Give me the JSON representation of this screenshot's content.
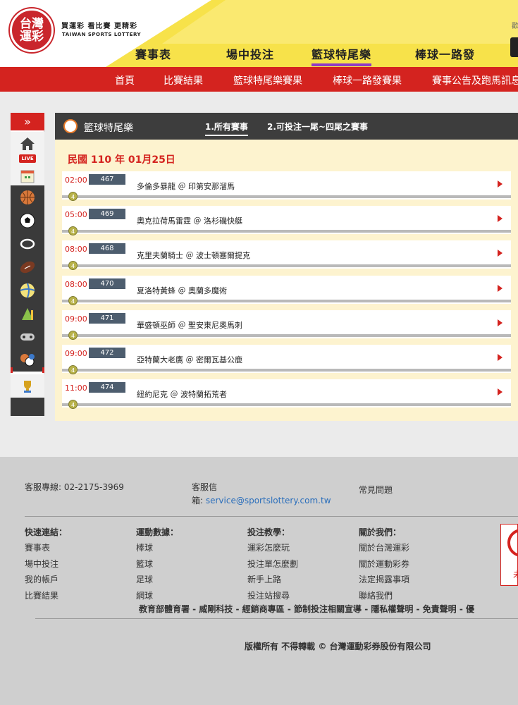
{
  "header": {
    "logo_line1": "台灣",
    "logo_line2": "運彩",
    "slogan": "買運彩  看比賽  更精彩",
    "brand_en": "TAIWAN SPORTS LOTTERY",
    "top_right": "歡",
    "nav": [
      {
        "label": "賽事表"
      },
      {
        "label": "場中投注"
      },
      {
        "label": "籃球特尾樂",
        "active": true
      },
      {
        "label": "棒球一路發"
      }
    ]
  },
  "subnav": [
    "首頁",
    "比賽結果",
    "籃球特尾樂賽果",
    "棒球一路發賽果",
    "賽事公告及跑馬訊息"
  ],
  "sidebar": {
    "toggle": "»",
    "icons": [
      "home-icon",
      "live-icon",
      "calendar-icon",
      "basketball-icon",
      "soccer-icon",
      "ring-icon",
      "football-icon",
      "volleyball-icon",
      "chart-icon",
      "gamepad-icon",
      "multi-sport-icon",
      "trophy-icon"
    ],
    "live_label": "LIVE"
  },
  "panel": {
    "title": "籃球特尾樂",
    "tabs": [
      {
        "label": "1.所有賽事",
        "active": true
      },
      {
        "label": "2.可投注一尾~四尾之賽事"
      }
    ],
    "date": "民國 110 年 01月25日",
    "games": [
      {
        "time": "02:00",
        "num": "467",
        "teams": "多倫多暴龍 ＠ 印第安那溜馬",
        "badge": "4"
      },
      {
        "time": "05:00",
        "num": "469",
        "teams": "奧克拉荷馬雷霆 ＠ 洛杉磯快艇",
        "badge": "4"
      },
      {
        "time": "08:00",
        "num": "468",
        "teams": "克里夫蘭騎士 ＠ 波士頓塞爾提克",
        "badge": "4"
      },
      {
        "time": "08:00",
        "num": "470",
        "teams": "夏洛特黃蜂 ＠ 奧蘭多魔術",
        "badge": "4"
      },
      {
        "time": "09:00",
        "num": "471",
        "teams": "華盛頓巫師 ＠ 聖安東尼奧馬刺",
        "badge": "4"
      },
      {
        "time": "09:00",
        "num": "472",
        "teams": "亞特蘭大老鷹 ＠ 密爾瓦基公鹿",
        "badge": "4"
      },
      {
        "time": "11:00",
        "num": "474",
        "teams": "紐約尼克 ＠ 波特蘭拓荒者",
        "badge": "4"
      }
    ]
  },
  "footer": {
    "hotline": "客服專線: 02-2175-3969",
    "mail_label_1": "客服信",
    "mail_label_2": "箱: ",
    "mail": "service@sportslottery.com.tw",
    "faq": "常見問題",
    "columns": [
      {
        "head": "快速連結：",
        "items": [
          "賽事表",
          "場中投注",
          "我的帳戶",
          "比賽結果"
        ]
      },
      {
        "head": "運動數據：",
        "items": [
          "棒球",
          "籃球",
          "足球",
          "網球"
        ]
      },
      {
        "head": "投注教學：",
        "items": [
          "運彩怎麼玩",
          "投注單怎麼劃",
          "新手上路",
          "投注站搜尋"
        ]
      },
      {
        "head": "關於我們：",
        "items": [
          "關於台灣運彩",
          "關於運動彩券",
          "法定揭露事項",
          "聯絡我們"
        ]
      }
    ],
    "policy": "教育部體育署 - 威剛科技 - 經銷商專區 - 節制投注相關宣導 - 隱私權聲明 - 免責聲明 - 優",
    "copyright": "版權所有 不得轉載 © 台灣運動彩券股份有限公司",
    "side_card_text": "未"
  }
}
